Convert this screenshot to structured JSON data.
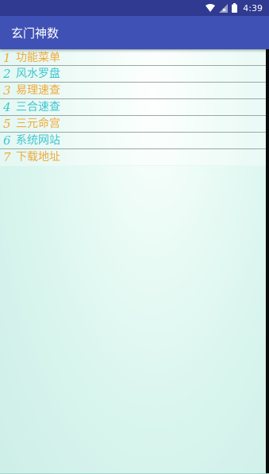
{
  "status_bar": {
    "time": "4:39",
    "icons": [
      "wifi-icon",
      "signal-icon",
      "battery-icon"
    ]
  },
  "app_bar": {
    "title": "玄门神数"
  },
  "menu": {
    "items": [
      {
        "num": "1",
        "label": "功能菜单",
        "color": "#f0a93a"
      },
      {
        "num": "2",
        "label": "风水罗盘",
        "color": "#3fc5cf"
      },
      {
        "num": "3",
        "label": "易理速查",
        "color": "#f0a93a"
      },
      {
        "num": "4",
        "label": "三合速查",
        "color": "#3fc5cf"
      },
      {
        "num": "5",
        "label": "三元命宫",
        "color": "#f0a93a"
      },
      {
        "num": "6",
        "label": "系统网站",
        "color": "#3fc5cf"
      },
      {
        "num": "7",
        "label": "下载地址",
        "color": "#f0a93a"
      }
    ]
  },
  "colors": {
    "status_bar": "#2f3a90",
    "app_bar": "#3f51b5",
    "accent_orange": "#f0a93a",
    "accent_teal": "#3fc5cf",
    "background": "#d9f5ee"
  }
}
